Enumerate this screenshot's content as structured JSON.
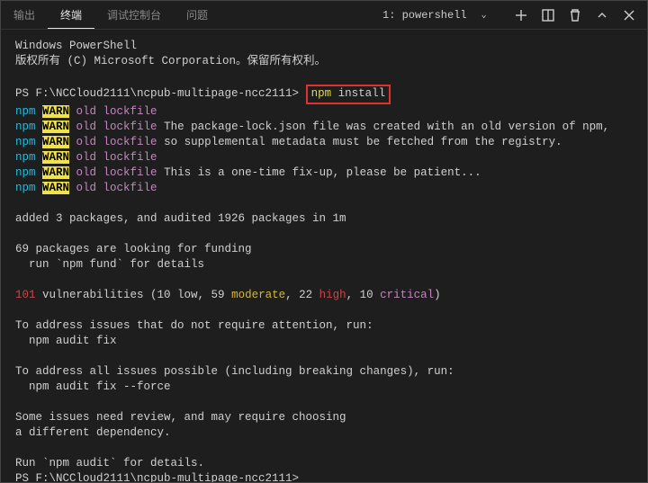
{
  "tabs": {
    "output": "输出",
    "terminal": "终端",
    "debug": "调试控制台",
    "problems": "问题"
  },
  "dropdown": {
    "label": "1: powershell"
  },
  "intro": {
    "line1": "Windows PowerShell",
    "line2": "版权所有 (C) Microsoft Corporation。保留所有权利。"
  },
  "prompt1": {
    "path": "PS F:\\NCCloud2111\\ncpub-multipage-ncc2111> ",
    "cmd_npm": "npm",
    "cmd_rest": " install"
  },
  "warn": {
    "npm": "npm ",
    "warn": "WARN",
    "tag": " old lockfile",
    "msg2": " The package-lock.json file was created with an old version of npm,",
    "msg3": " so supplemental metadata must be fetched from the registry.",
    "msg5": " This is a one-time fix-up, please be patient..."
  },
  "added": "added 3 packages, and audited 1926 packages in 1m",
  "funding": {
    "l1": "69 packages are looking for funding",
    "l2": "  run `npm fund` for details"
  },
  "vuln": {
    "num": "101",
    "rest1": " vulnerabilities (10 low, 59 ",
    "moderate": "moderate",
    "rest2": ", 22 ",
    "high": "high",
    "rest3": ", 10 ",
    "critical": "critical",
    "rest4": ")"
  },
  "fix1": {
    "l1": "To address issues that do not require attention, run:",
    "l2": "  npm audit fix"
  },
  "fix2": {
    "l1": "To address all issues possible (including breaking changes), run:",
    "l2": "  npm audit fix --force"
  },
  "review": {
    "l1": "Some issues need review, and may require choosing",
    "l2": "a different dependency."
  },
  "audit": "Run `npm audit` for details.",
  "prompt2": "PS F:\\NCCloud2111\\ncpub-multipage-ncc2111>"
}
